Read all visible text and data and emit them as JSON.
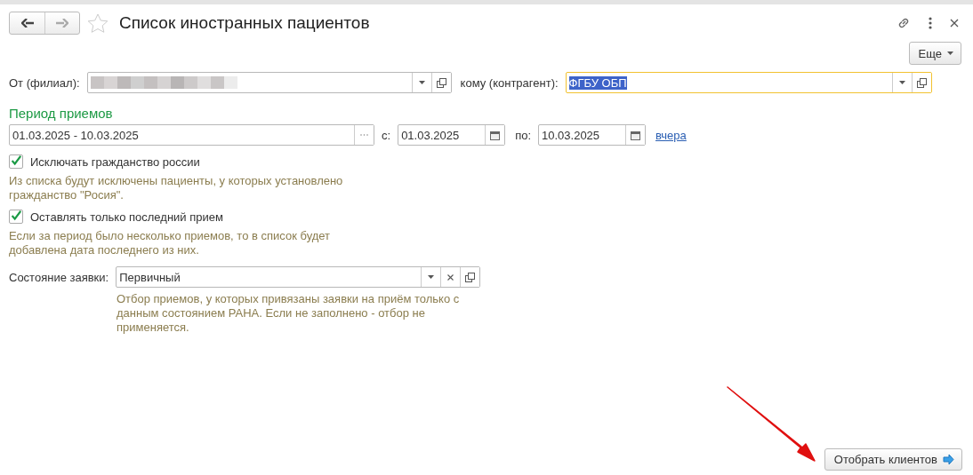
{
  "window": {
    "title": "Список иностранных пациентов",
    "favorite": false
  },
  "more_button": {
    "label": "Еще"
  },
  "from_field": {
    "label": "От (филиал):",
    "redacted": true
  },
  "to_field": {
    "label": "кому (контрагент):",
    "value": "ФГБУ ОБП",
    "focused": true
  },
  "period": {
    "heading": "Период приемов",
    "range": "01.03.2025 - 10.03.2025",
    "from_label": "с:",
    "from": "01.03.2025",
    "to_label": "по:",
    "to": "10.03.2025",
    "link": "вчера"
  },
  "options": [
    {
      "label": "Исключать гражданство россии",
      "checked": true,
      "note": "Из списка будут исключены пациенты, у которых установлено гражданство \"Росия\"."
    },
    {
      "label": "Оставлять только последний прием",
      "checked": true,
      "note": "Если за период было несколько приемов, то в список будет добавлена дата последнего из них."
    }
  ],
  "state_field": {
    "label": "Состояние заявки:",
    "value": "Первичный",
    "note": "Отбор приемов, у которых привязаны заявки на приём только с данным состоянием РАНА. Если не заполнено - отбор не применяется."
  },
  "action_button": {
    "label": "Отобрать клиентов"
  }
}
